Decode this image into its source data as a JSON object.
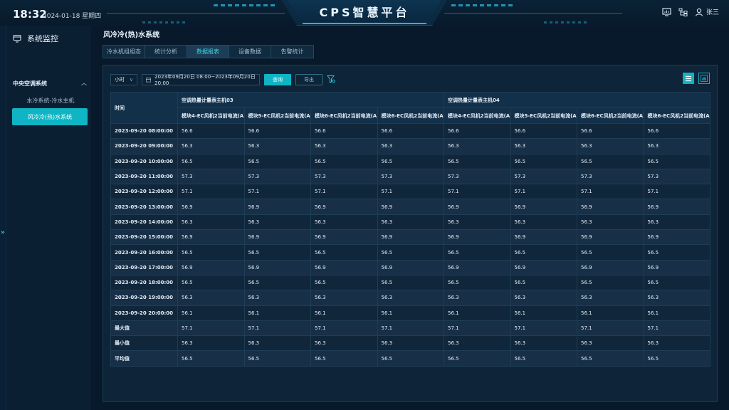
{
  "header": {
    "time": "18:32",
    "date": "2024-01-18 星期四",
    "title": "CPS智慧平台",
    "user": "张三"
  },
  "sidebar": {
    "title": "系统监控",
    "group": "中央空调系统",
    "items": [
      {
        "label": "水冷系统-冷水主机",
        "active": false
      },
      {
        "label": "风冷冷(热)水系统",
        "active": true
      }
    ]
  },
  "page": {
    "title": "风冷冷(热)水系统",
    "tabs": [
      {
        "label": "冷水机组组态",
        "active": false
      },
      {
        "label": "统计分析",
        "active": false
      },
      {
        "label": "数据报表",
        "active": true
      },
      {
        "label": "设备数据",
        "active": false
      },
      {
        "label": "告警统计",
        "active": false
      }
    ]
  },
  "toolbar": {
    "interval": "小时",
    "range": "2023年09月20日 08:00~2023年09月20日 20:00",
    "query_label": "查询",
    "export_label": "导出"
  },
  "colors": {
    "accent": "#0fb5c4",
    "background": "#07192b",
    "panel": "#0e2438"
  },
  "table": {
    "time_header": "时间",
    "groups": [
      "空调热量计量表主机03",
      "空调热量计量表主机04"
    ],
    "columns": [
      "模块4-EC风机2当前电流(A)",
      "模块5-EC风机2当前电流(A)",
      "模块6-EC风机2当前电流(A)",
      "模块6-EC风机2当前电流(A)",
      "模块4-EC风机2当前电流(A)",
      "模块5-EC风机2当前电流(A)",
      "模块6-EC风机2当前电流(A)",
      "模块6-EC风机2当前电流(A)"
    ],
    "rows": [
      {
        "label": "2023-09-20 08:00:00",
        "value": "56.6"
      },
      {
        "label": "2023-09-20 09:00:00",
        "value": "56.3"
      },
      {
        "label": "2023-09-20 10:00:00",
        "value": "56.5"
      },
      {
        "label": "2023-09-20 11:00:00",
        "value": "57.3"
      },
      {
        "label": "2023-09-20 12:00:00",
        "value": "57.1"
      },
      {
        "label": "2023-09-20 13:00:00",
        "value": "56.9"
      },
      {
        "label": "2023-09-20 14:00:00",
        "value": "56.3"
      },
      {
        "label": "2023-09-20 15:00:00",
        "value": "56.9"
      },
      {
        "label": "2023-09-20 16:00:00",
        "value": "56.5"
      },
      {
        "label": "2023-09-20 17:00:00",
        "value": "56.9"
      },
      {
        "label": "2023-09-20 18:00:00",
        "value": "56.5"
      },
      {
        "label": "2023-09-20 19:00:00",
        "value": "56.3"
      },
      {
        "label": "2023-09-20 20:00:00",
        "value": "56.1"
      },
      {
        "label": "最大值",
        "value": "57.1"
      },
      {
        "label": "最小值",
        "value": "56.3"
      },
      {
        "label": "平均值",
        "value": "56.5"
      }
    ]
  }
}
